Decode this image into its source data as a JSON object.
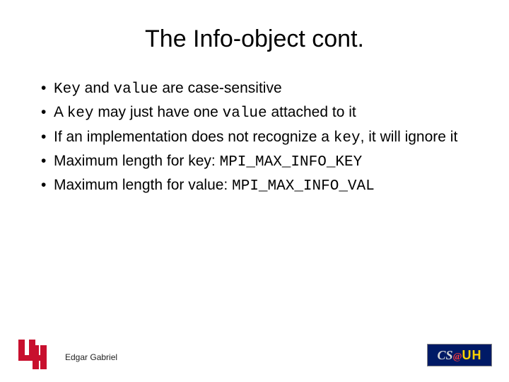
{
  "title": "The Info-object cont.",
  "bullets": {
    "b1": {
      "pre": "",
      "code1": "Key",
      "mid1": " and ",
      "code2": "value",
      "post": " are case-sensitive"
    },
    "b2": {
      "pre": "A ",
      "code1": "key",
      "mid1": " may just have one ",
      "code2": "value",
      "post": " attached to it"
    },
    "b3": {
      "pre": "If an implementation does not recognize a ",
      "code1": "key",
      "post": ", it will ignore it"
    },
    "b4": {
      "pre": "Maximum length for key: ",
      "code1": "MPI_MAX_INFO_KEY"
    },
    "b5": {
      "pre": "Maximum length for value: ",
      "code1": "MPI_MAX_INFO_VAL"
    }
  },
  "footer": {
    "author": "Edgar Gabriel",
    "cs_logo": {
      "cs": "CS",
      "at": "@",
      "uh": "UH"
    }
  }
}
